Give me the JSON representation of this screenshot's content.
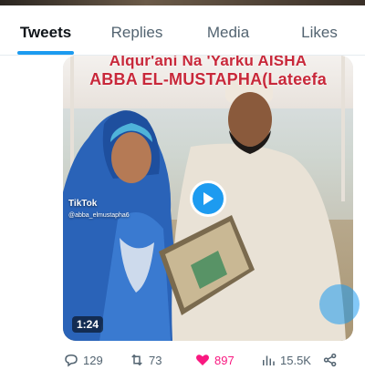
{
  "tabs": [
    {
      "label": "Tweets",
      "active": true
    },
    {
      "label": "Replies",
      "active": false
    },
    {
      "label": "Media",
      "active": false
    },
    {
      "label": "Likes",
      "active": false
    }
  ],
  "media": {
    "caption_line1": "Alqur'ani Na 'Yarku AISHA",
    "caption_line2": "ABBA EL-MUSTAPHA(Lateefa",
    "watermark_brand": "TikTok",
    "watermark_handle": "@abba_elmustapha6",
    "duration": "1:24"
  },
  "actions": {
    "replies": "129",
    "retweets": "73",
    "likes": "897",
    "views": "15.5K"
  },
  "colors": {
    "accent": "#1d9bf0",
    "like": "#f91880",
    "caption": "#c8283a",
    "muted": "#536471"
  },
  "icons": {
    "reply": "comment-icon",
    "retweet": "retweet-icon",
    "like": "heart-icon",
    "views": "bar-chart-icon",
    "share": "share-icon",
    "play": "play-icon"
  }
}
